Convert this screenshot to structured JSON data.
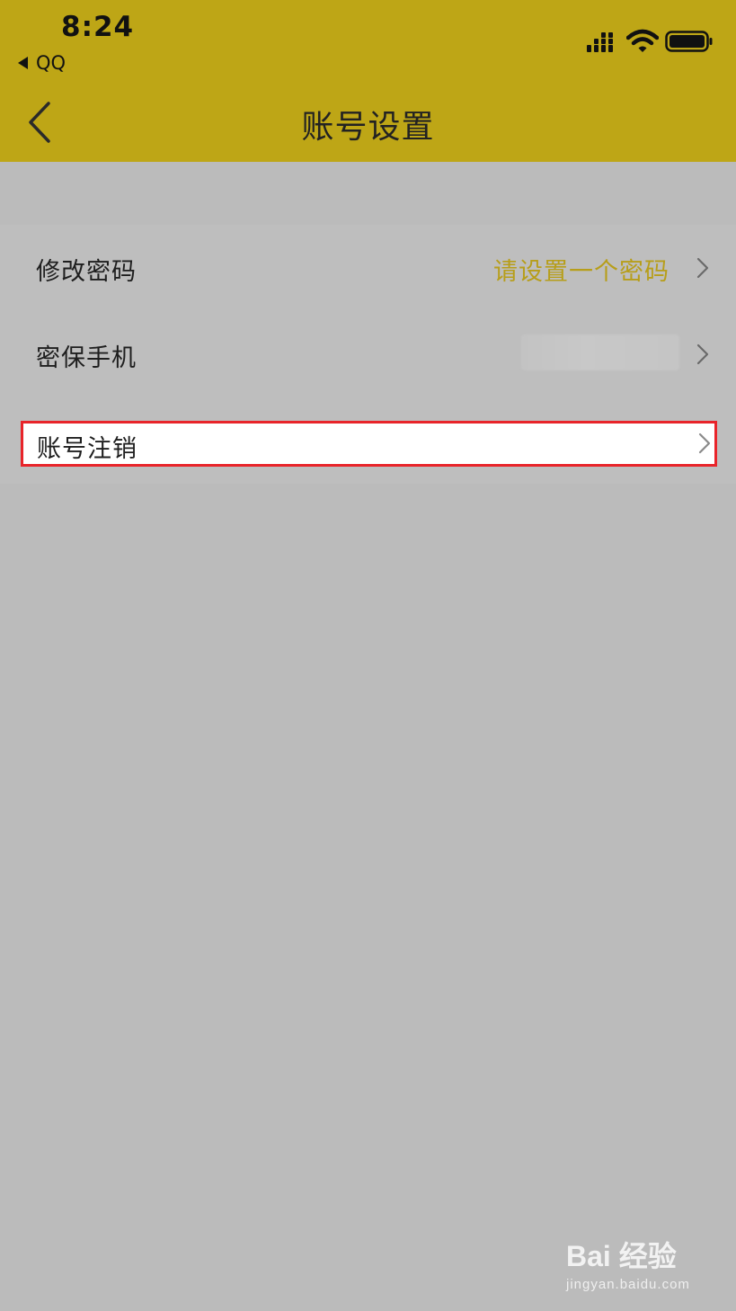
{
  "status_bar": {
    "time": "8:24",
    "back_app": "QQ",
    "icons": [
      "signal-icon",
      "wifi-icon",
      "battery-icon"
    ]
  },
  "nav": {
    "title": "账号设置",
    "back_icon": "chevron-left-icon"
  },
  "settings": [
    {
      "label": "修改密码",
      "value": "请设置一个密码"
    },
    {
      "label": "密保手机",
      "value": ""
    },
    {
      "label": "账号注销",
      "value": ""
    }
  ],
  "watermark": {
    "logo": "Bai 经验",
    "url": "jingyan.baidu.com"
  },
  "colors": {
    "header": "#bea616",
    "accent_text": "#b79e1a",
    "highlight_border": "#e8242a",
    "background": "#bbbbbb"
  }
}
